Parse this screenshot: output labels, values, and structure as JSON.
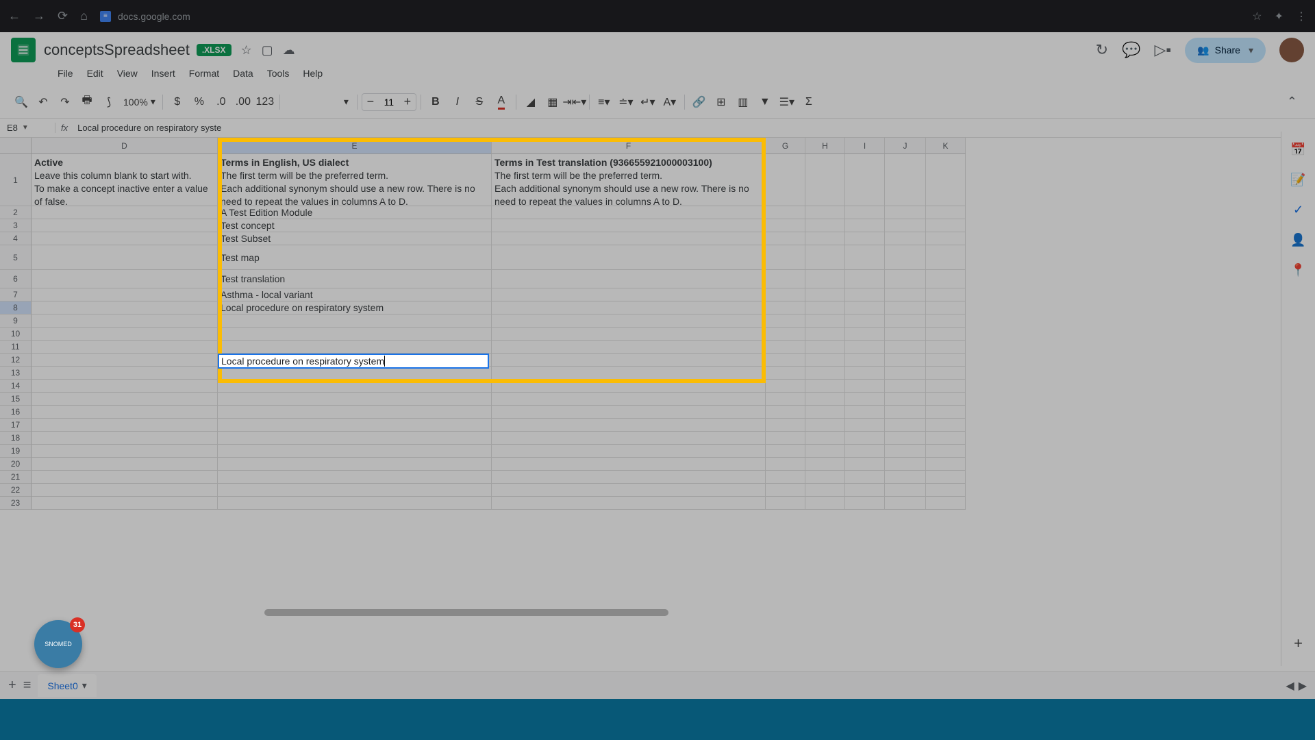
{
  "browser": {
    "url": "docs.google.com"
  },
  "doc": {
    "title": "conceptsSpreadsheet",
    "badge": ".XLSX"
  },
  "menu": [
    "File",
    "Edit",
    "View",
    "Insert",
    "Format",
    "Data",
    "Tools",
    "Help"
  ],
  "toolbar": {
    "zoom": "100%",
    "font_size": "11",
    "format_123": "123"
  },
  "share_label": "Share",
  "name_box": "E8",
  "formula": "Local procedure on respiratory syste",
  "columns": [
    "D",
    "E",
    "F",
    "G",
    "H",
    "I",
    "J",
    "K"
  ],
  "rows_count": 23,
  "header_row": {
    "D": {
      "title": "Active",
      "desc": "Leave this column blank to start with.\nTo make a concept inactive enter a value of false."
    },
    "E": {
      "title": "Terms in English, US dialect",
      "desc": "The first term will be the preferred term.\nEach additional synonym should use a new row. There is no need to repeat the values in columns A to D."
    },
    "F": {
      "title": "Terms in Test translation (936655921000003100)",
      "desc": "The first term will be the preferred term.\nEach additional synonym should use a new row. There is no need to repeat the values in columns A to D."
    }
  },
  "data_E": {
    "2": "A Test Edition Module",
    "3": "Test concept",
    "4": "Test Subset",
    "5": "Test map",
    "6": "Test translation",
    "7": "Asthma - local variant",
    "8": "Local procedure on respiratory system"
  },
  "sheet_name": "Sheet0",
  "snomed": {
    "label": "SNOMED",
    "count": "31"
  }
}
